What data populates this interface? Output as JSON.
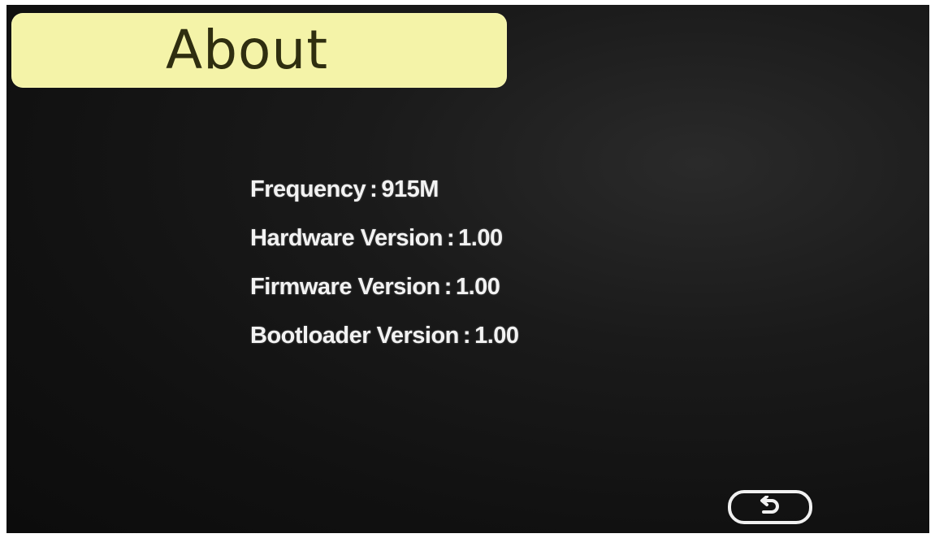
{
  "header": {
    "title": "About"
  },
  "info": {
    "rows": [
      {
        "label": "Frequency",
        "separator": ":",
        "value": "915M"
      },
      {
        "label": "Hardware Version",
        "separator": ":",
        "value": "1.00"
      },
      {
        "label": "Firmware Version",
        "separator": ":",
        "value": "1.00"
      },
      {
        "label": "Bootloader Version",
        "separator": ":",
        "value": "1.00"
      }
    ]
  },
  "footer": {
    "back_icon": "return-arrow-icon"
  },
  "colors": {
    "background": "#111111",
    "title_bar": "#f4f3a8",
    "title_text": "#2f2e10",
    "text": "#f2f2f2"
  }
}
